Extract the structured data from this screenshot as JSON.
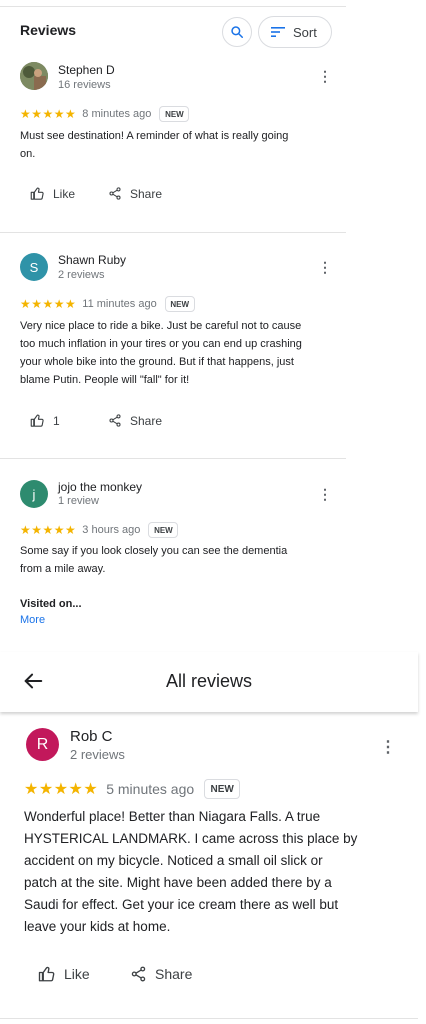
{
  "header": {
    "title": "Reviews",
    "sort_label": "Sort"
  },
  "reviews_top": [
    {
      "name": "Stephen D",
      "count": "16 reviews",
      "stars": "★★★★★",
      "time": "8 minutes ago",
      "badge": "NEW",
      "lines": [
        "Must see destination! A reminder of what is really going",
        "on."
      ],
      "like_label": "Like",
      "share_label": "Share"
    },
    {
      "name": "Shawn Ruby",
      "initial": "S",
      "count": "2 reviews",
      "stars": "★★★★★",
      "time": "11 minutes ago",
      "badge": "NEW",
      "lines": [
        "Very nice place to ride a bike. Just be careful not to cause",
        "too much inflation in your tires or you can end up crashing",
        "your whole bike into the ground. But if that happens, just",
        "blame Putin. People will \"fall\" for it!"
      ],
      "like_label": "1",
      "share_label": "Share"
    },
    {
      "name": "jojo the monkey",
      "initial": "j",
      "count": "1 review",
      "stars": "★★★★★",
      "time": "3 hours ago",
      "badge": "NEW",
      "lines": [
        "Some say if you look closely you can see the dementia",
        "from a mile away."
      ],
      "visited": "Visited on...",
      "more": "More"
    }
  ],
  "all_reviews": {
    "title": "All reviews"
  },
  "review_bottom": {
    "name": "Rob C",
    "initial": "R",
    "count": "2 reviews",
    "stars": "★★★★★",
    "time": "5 minutes ago",
    "badge": "NEW",
    "lines": [
      "Wonderful place!  Better than Niagara Falls.  A true",
      "HYSTERICAL LANDMARK.  I came across this place by",
      "accident on my bicycle.  Noticed a small oil slick or",
      "patch at the site.  Might have been added there by a",
      "Saudi for effect.  Get your ice cream there as well but",
      "leave your kids at home."
    ],
    "like_label": "Like",
    "share_label": "Share"
  },
  "colors": {
    "star": "#f4b400",
    "avatar_shawn": "#2f93a8",
    "avatar_jojo": "#2e8b6f",
    "avatar_rob": "#c2185b",
    "link": "#1a73e8"
  }
}
